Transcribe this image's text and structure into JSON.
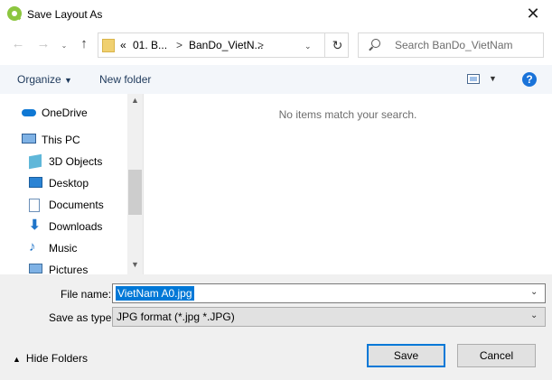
{
  "window": {
    "title": "Save Layout As"
  },
  "address": {
    "crumbs": [
      "«",
      "01. B...",
      "BanDo_VietN..."
    ],
    "separator": ">"
  },
  "search": {
    "placeholder": "Search BanDo_VietNam"
  },
  "toolbar": {
    "organize_label": "Organize",
    "new_folder_label": "New folder",
    "help_label": "?"
  },
  "nav_pane": {
    "items": [
      {
        "label": "OneDrive",
        "icon": "onedrive-cloud-icon"
      },
      {
        "label": "This PC",
        "icon": "computer-icon"
      },
      {
        "label": "3D Objects",
        "icon": "3d-objects-icon"
      },
      {
        "label": "Desktop",
        "icon": "desktop-icon"
      },
      {
        "label": "Documents",
        "icon": "documents-icon"
      },
      {
        "label": "Downloads",
        "icon": "downloads-icon"
      },
      {
        "label": "Music",
        "icon": "music-icon"
      },
      {
        "label": "Pictures",
        "icon": "pictures-icon"
      }
    ]
  },
  "file_list": {
    "empty_message": "No items match your search."
  },
  "form": {
    "file_name_label": "File name:",
    "file_name_value": "VietNam A0.jpg",
    "save_as_type_label": "Save as type:",
    "save_as_type_value": "JPG format (*.jpg *.JPG)"
  },
  "footer": {
    "hide_folders_label": "Hide Folders",
    "save_label": "Save",
    "cancel_label": "Cancel"
  },
  "colors": {
    "accent": "#0078d7",
    "command_bar": "#f3f6fa",
    "footer_bg": "#f0f0f0"
  }
}
